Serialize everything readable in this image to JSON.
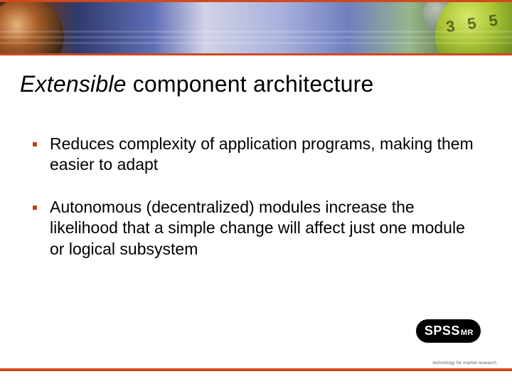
{
  "title": {
    "emphasis": "Extensible",
    "rest": " component architecture"
  },
  "bullets": [
    "Reduces complexity of application programs, making them easier to adapt",
    "Autonomous (decentralized) modules increase the likelihood that a simple change will affect just one module or logical subsystem"
  ],
  "logo": {
    "main": "SPSS",
    "sub": "MR",
    "tagline": "technology for market research"
  },
  "colors": {
    "accent": "#d0481c"
  }
}
